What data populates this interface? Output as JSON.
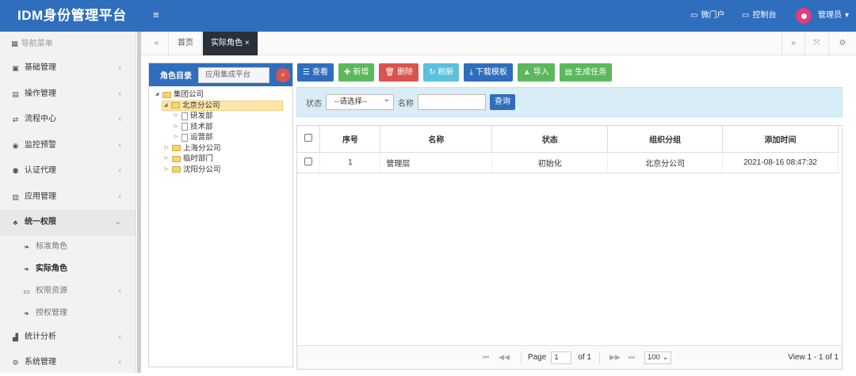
{
  "app": {
    "title": "IDM身份管理平台",
    "menu_toggle": "≡"
  },
  "topbar": {
    "portal": "微门户",
    "console": "控制台",
    "user": "管理员"
  },
  "sidebar": {
    "header": "导航菜单",
    "items": [
      {
        "label": "基础管理",
        "icon": "id-card-icon"
      },
      {
        "label": "操作管理",
        "icon": "book-icon"
      },
      {
        "label": "流程中心",
        "icon": "shuffle-icon"
      },
      {
        "label": "监控预警",
        "icon": "eye-icon"
      },
      {
        "label": "认证代理",
        "icon": "users-icon"
      },
      {
        "label": "应用管理",
        "icon": "grid-icon"
      },
      {
        "label": "统一权限",
        "icon": "sitemap-icon"
      }
    ],
    "subitems": [
      {
        "label": "标准角色"
      },
      {
        "label": "实际角色"
      },
      {
        "label": "权限资源"
      },
      {
        "label": "授权管理"
      }
    ],
    "bottom_items": [
      {
        "label": "统计分析",
        "icon": "chart-icon"
      },
      {
        "label": "系统管理",
        "icon": "cogs-icon"
      }
    ]
  },
  "tabs": {
    "home": "首页",
    "current": "实际角色",
    "close": "×"
  },
  "tree": {
    "title": "角色目录",
    "search_placeholder": "应用集成平台",
    "nodes": [
      "集团公司",
      "北京分公司",
      "研发部",
      "技术部",
      "运营部",
      "上海分公司",
      "临时部门",
      "沈阳分公司"
    ]
  },
  "toolbar": {
    "view": "查看",
    "add": "新增",
    "delete": "删除",
    "refresh": "刷新",
    "download": "下载模板",
    "import": "导入",
    "generate": "生成任务"
  },
  "filter": {
    "status_label": "状态",
    "status_value": "--请选择--",
    "name_label": "名称",
    "query": "查询"
  },
  "table": {
    "headers": [
      "序号",
      "名称",
      "状态",
      "组织分组",
      "添加时间"
    ],
    "rows": [
      {
        "no": "1",
        "name": "管理层",
        "status": "初始化",
        "org": "北京分公司",
        "time": "2021-08-16 08:47:32"
      }
    ]
  },
  "pager": {
    "page_label": "Page",
    "page_value": "1",
    "of_label": "of 1",
    "page_size": "100",
    "view": "View 1 - 1 of 1"
  },
  "colors": {
    "primary": "#2f6ebd",
    "danger": "#d9534f",
    "info": "#5bc0de",
    "success": "#5cb85c",
    "dark_tab": "#2a2f3a"
  }
}
